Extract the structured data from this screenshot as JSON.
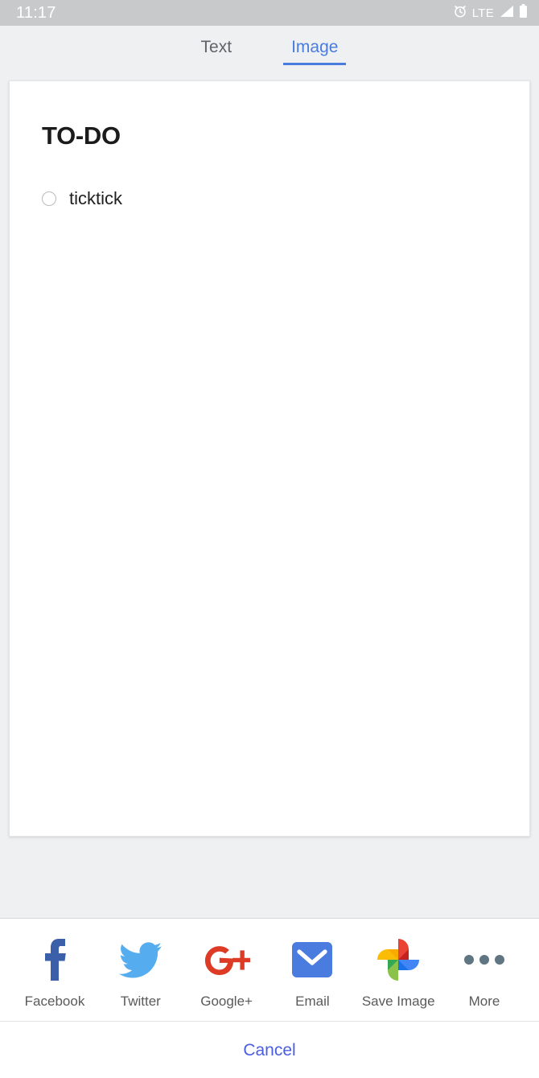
{
  "status_bar": {
    "time": "11:17",
    "network_label": "LTE",
    "icons": [
      "alarm-icon",
      "signal-icon",
      "battery-icon"
    ],
    "background_color": "#c8c9cb",
    "text_color": "#ffffff"
  },
  "tabs": {
    "accent_color": "#4a7ce0",
    "inactive_color": "#5f6368",
    "items": [
      {
        "label": "Text",
        "active": false
      },
      {
        "label": "Image",
        "active": true
      }
    ]
  },
  "note_card": {
    "title": "TO-DO",
    "tasks": [
      {
        "label": "ticktick",
        "checked": false
      }
    ]
  },
  "share_sheet": {
    "targets": [
      {
        "label": "Facebook",
        "icon": "facebook-icon",
        "color": "#3b5fa9"
      },
      {
        "label": "Twitter",
        "icon": "twitter-icon",
        "color": "#55acee"
      },
      {
        "label": "Google+",
        "icon": "google-plus-icon",
        "color": "#dd3b26"
      },
      {
        "label": "Email",
        "icon": "email-icon",
        "color": "#4a7ce0"
      },
      {
        "label": "Save Image",
        "icon": "google-photos-icon",
        "color": "#fbbc05"
      },
      {
        "label": "More",
        "icon": "more-dots-icon",
        "color": "#5f7581"
      }
    ],
    "cancel_label": "Cancel",
    "cancel_color": "#4a5ee0"
  }
}
